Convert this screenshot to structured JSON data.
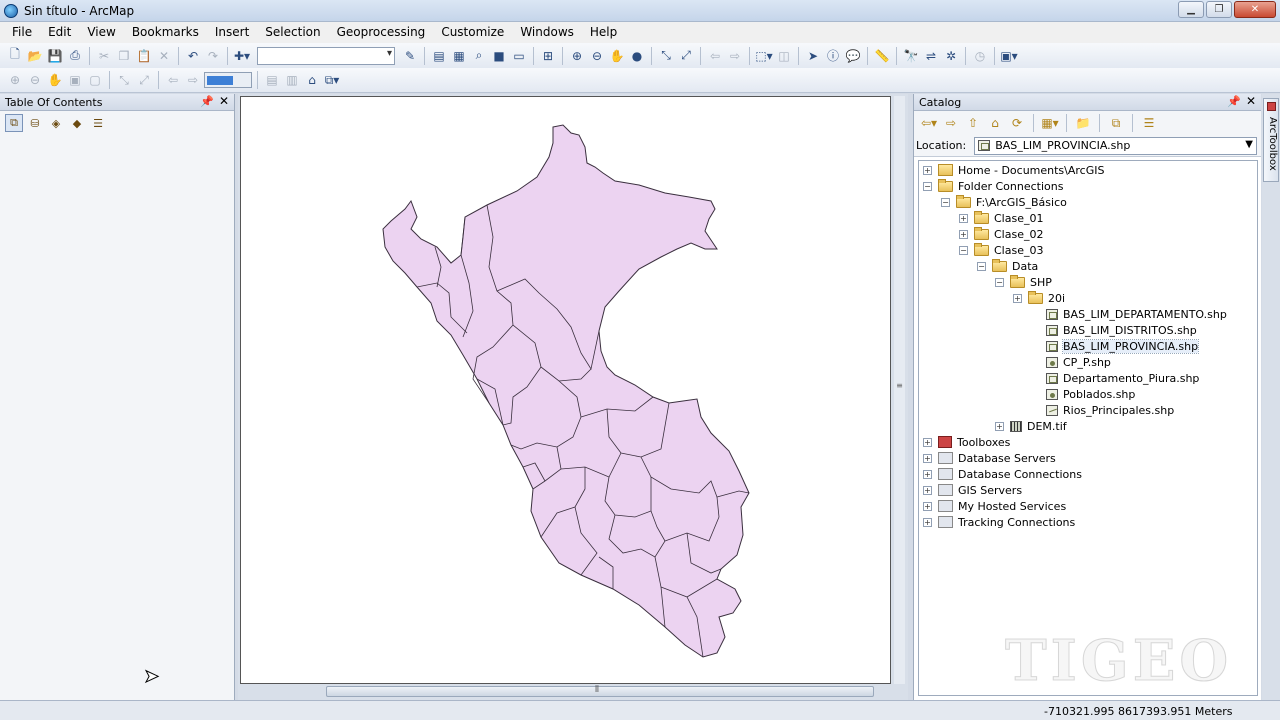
{
  "window": {
    "title": "Sin título - ArcMap"
  },
  "menu": [
    "File",
    "Edit",
    "View",
    "Bookmarks",
    "Insert",
    "Selection",
    "Geoprocessing",
    "Customize",
    "Windows",
    "Help"
  ],
  "toc": {
    "title": "Table Of Contents"
  },
  "catalog": {
    "title": "Catalog",
    "location_label": "Location:",
    "location_value": "BAS_LIM_PROVINCIA.shp",
    "tree": [
      {
        "label": "Home - Documents\\ArcGIS",
        "level": 0,
        "exp": "+",
        "icon": "home"
      },
      {
        "label": "Folder Connections",
        "level": 0,
        "exp": "-",
        "icon": "folder"
      },
      {
        "label": "F:\\ArcGIS_Básico",
        "level": 1,
        "exp": "-",
        "icon": "folder"
      },
      {
        "label": "Clase_01",
        "level": 2,
        "exp": "+",
        "icon": "folder"
      },
      {
        "label": "Clase_02",
        "level": 2,
        "exp": "+",
        "icon": "folder"
      },
      {
        "label": "Clase_03",
        "level": 2,
        "exp": "-",
        "icon": "folder"
      },
      {
        "label": "Data",
        "level": 3,
        "exp": "-",
        "icon": "folder"
      },
      {
        "label": "SHP",
        "level": 4,
        "exp": "-",
        "icon": "folder"
      },
      {
        "label": "20i",
        "level": 5,
        "exp": "+",
        "icon": "folder"
      },
      {
        "label": "BAS_LIM_DEPARTAMENTO.shp",
        "level": 6,
        "exp": "",
        "icon": "shp"
      },
      {
        "label": "BAS_LIM_DISTRITOS.shp",
        "level": 6,
        "exp": "",
        "icon": "shp"
      },
      {
        "label": "BAS_LIM_PROVINCIA.shp",
        "level": 6,
        "exp": "",
        "icon": "shp",
        "selected": true
      },
      {
        "label": "CP_P.shp",
        "level": 6,
        "exp": "",
        "icon": "pt"
      },
      {
        "label": "Departamento_Piura.shp",
        "level": 6,
        "exp": "",
        "icon": "shp"
      },
      {
        "label": "Poblados.shp",
        "level": 6,
        "exp": "",
        "icon": "pt"
      },
      {
        "label": "Rios_Principales.shp",
        "level": 6,
        "exp": "",
        "icon": "line"
      },
      {
        "label": "DEM.tif",
        "level": 4,
        "exp": "+",
        "icon": "raster"
      },
      {
        "label": "Toolboxes",
        "level": 0,
        "exp": "+",
        "icon": "toolbox"
      },
      {
        "label": "Database Servers",
        "level": 0,
        "exp": "+",
        "icon": "gen"
      },
      {
        "label": "Database Connections",
        "level": 0,
        "exp": "+",
        "icon": "gen"
      },
      {
        "label": "GIS Servers",
        "level": 0,
        "exp": "+",
        "icon": "gen"
      },
      {
        "label": "My Hosted Services",
        "level": 0,
        "exp": "+",
        "icon": "gen"
      },
      {
        "label": "Tracking Connections",
        "level": 0,
        "exp": "+",
        "icon": "gen"
      }
    ]
  },
  "side_tab": {
    "label": "ArcToolbox"
  },
  "status": {
    "coordinates": "-710321.995  8617393.951 Meters"
  },
  "watermark": "TIGEO",
  "colors": {
    "map_fill": "#ecd3f1",
    "map_stroke": "#3a2f3e"
  }
}
